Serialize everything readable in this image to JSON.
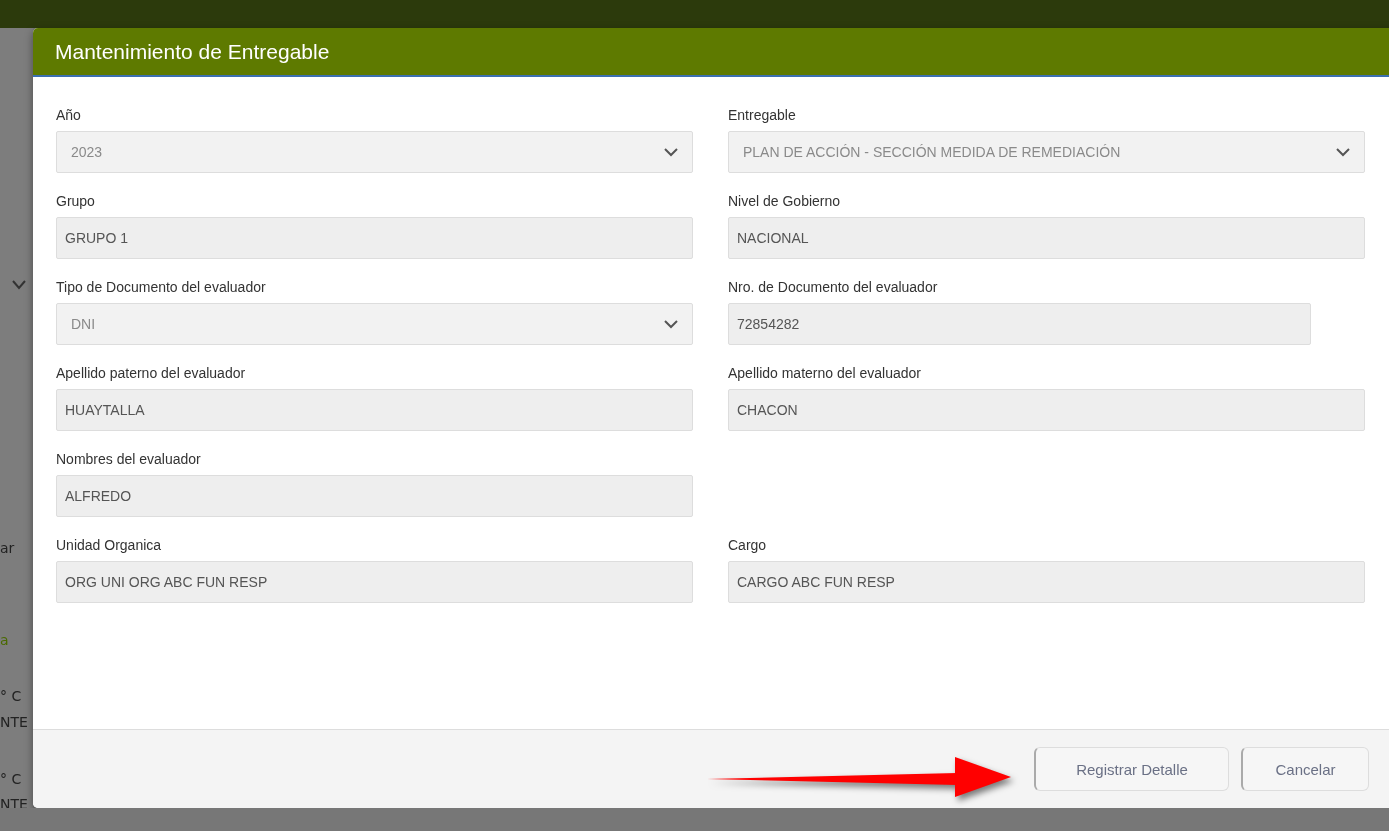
{
  "background": {
    "fragments": [
      "ar",
      "a",
      "° C",
      "NTE",
      "° C",
      "NTE"
    ]
  },
  "dialog": {
    "title": "Mantenimiento de Entregable",
    "rows": [
      [
        {
          "label": "Año",
          "kind": "select",
          "value": "2023",
          "disabled": true
        },
        {
          "label": "Entregable",
          "kind": "select",
          "value": "PLAN DE ACCIÓN - SECCIÓN MEDIDA DE REMEDIACIÓN",
          "disabled": true
        }
      ],
      [
        {
          "label": "Grupo",
          "kind": "text",
          "value": "GRUPO 1",
          "disabled": true
        },
        {
          "label": "Nivel de Gobierno",
          "kind": "text",
          "value": "NACIONAL",
          "disabled": true
        }
      ],
      [
        {
          "label": "Tipo de Documento del evaluador",
          "kind": "select",
          "value": "DNI",
          "disabled": true
        },
        {
          "label": "Nro. de Documento del evaluador",
          "kind": "short",
          "value": "72854282",
          "disabled": true
        }
      ],
      [
        {
          "label": "Apellido paterno del evaluador",
          "kind": "text",
          "value": "HUAYTALLA",
          "disabled": true
        },
        {
          "label": "Apellido materno del evaluador",
          "kind": "text",
          "value": "CHACON",
          "disabled": true
        }
      ],
      [
        {
          "label": "Nombres del evaluador",
          "kind": "text",
          "value": "ALFREDO",
          "disabled": true
        }
      ],
      [
        {
          "label": "Unidad Organica",
          "kind": "text",
          "value": "ORG UNI ORG ABC FUN RESP",
          "disabled": true
        },
        {
          "label": "Cargo",
          "kind": "text",
          "value": "CARGO ABC FUN RESP",
          "disabled": true
        }
      ]
    ],
    "buttons": [
      "Registrar Detalle",
      "Cancelar"
    ]
  }
}
